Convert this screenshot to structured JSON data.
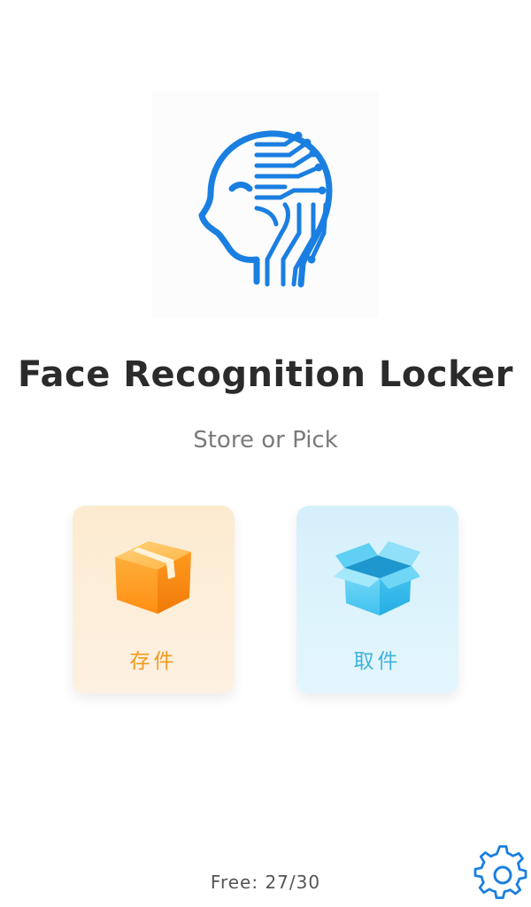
{
  "app": {
    "title": "Face Recognition Locker",
    "subtitle": "Store or Pick"
  },
  "actions": {
    "store_label": "存件",
    "pick_label": "取件"
  },
  "status": {
    "free_text": "Free: 27/30"
  },
  "icons": {
    "logo": "ai-head-circuit-icon",
    "store": "closed-box-icon",
    "pick": "open-box-icon",
    "settings": "gear-icon"
  },
  "colors": {
    "logo_blue": "#1a7fe0",
    "store_orange": "#f39a1c",
    "pick_blue": "#3fb3de",
    "title": "#2b2b2b"
  }
}
